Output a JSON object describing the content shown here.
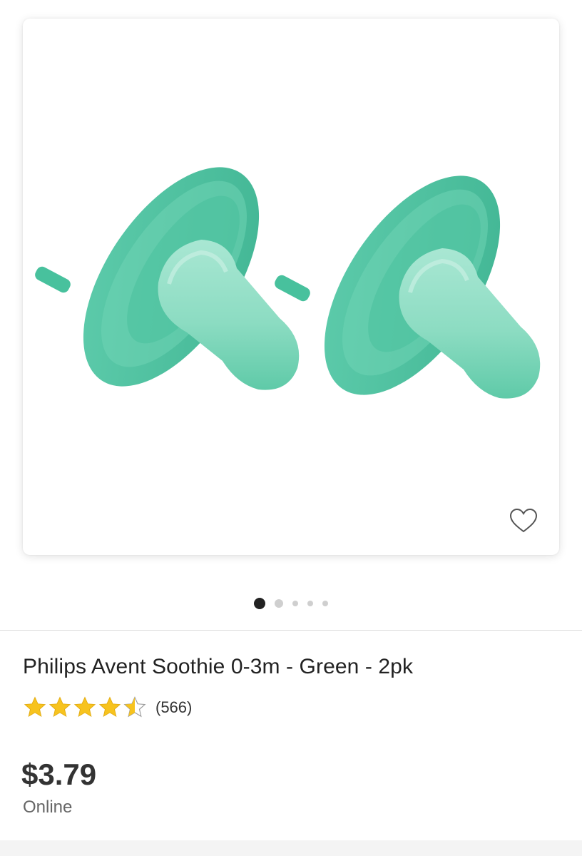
{
  "product": {
    "image": {
      "description_icon": "pacifier-image",
      "color": "#4cc3a1",
      "favorite_icon": "heart-outline-icon"
    },
    "carousel": {
      "count": 5,
      "active_index": 0
    },
    "title": "Philips Avent Soothie 0-3m - Green - 2pk",
    "rating": {
      "value": 4.5,
      "max": 5,
      "count_label": "(566)",
      "star_color": "#f7c31e"
    },
    "price": "$3.79",
    "channel": "Online"
  }
}
